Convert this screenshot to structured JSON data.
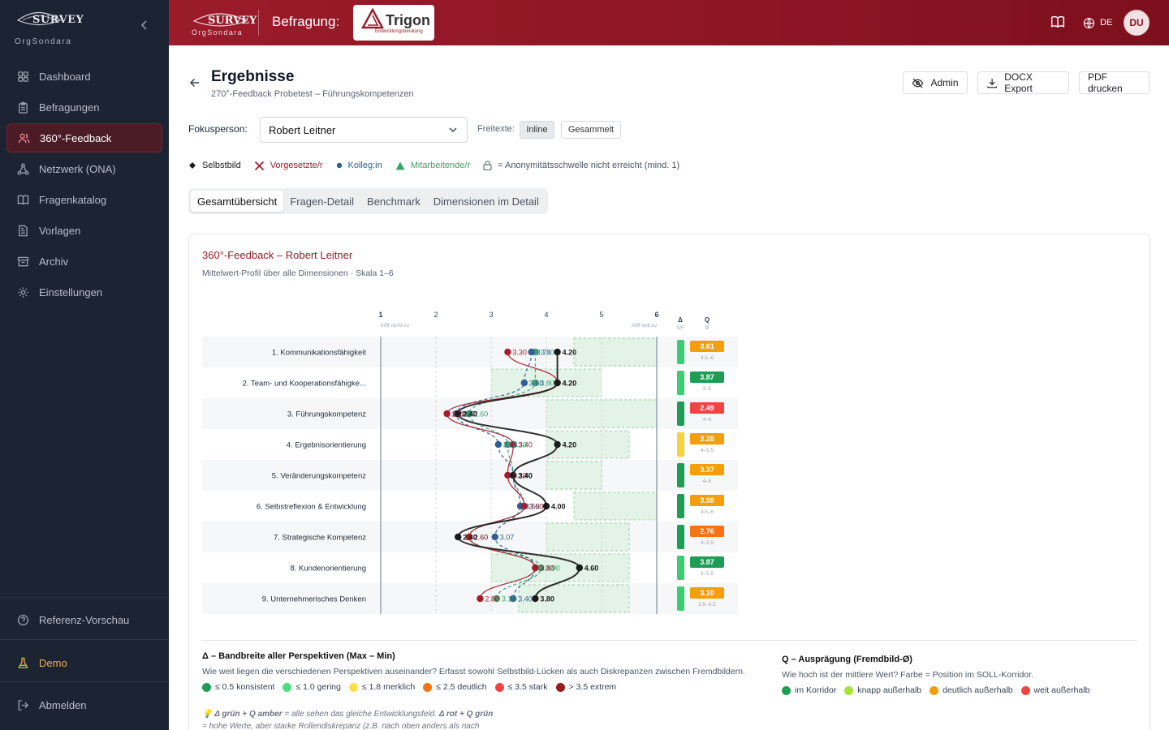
{
  "app": {
    "brand": "SURVEY",
    "brand_sub": "OrgSondara",
    "survey_label": "Befragung:",
    "client_name": "Trigon",
    "client_tag": "Entwicklungsberatung",
    "language": "DE",
    "avatar_initials": "DU",
    "accent_color": "#9b1b2a"
  },
  "sidebar": {
    "items": [
      {
        "label": "Dashboard",
        "icon": "grid-icon"
      },
      {
        "label": "Befragungen",
        "icon": "clipboard-icon"
      },
      {
        "label": "360°-Feedback",
        "icon": "users-icon",
        "active": true
      },
      {
        "label": "Netzwerk (ONA)",
        "icon": "network-icon"
      },
      {
        "label": "Fragenkatalog",
        "icon": "book-icon"
      },
      {
        "label": "Vorlagen",
        "icon": "file-icon"
      },
      {
        "label": "Archiv",
        "icon": "archive-icon"
      },
      {
        "label": "Einstellungen",
        "icon": "gear-icon"
      }
    ],
    "reference_preview": "Referenz-Vorschau",
    "demo": "Demo",
    "logout": "Abmelden"
  },
  "page": {
    "title": "Ergebnisse",
    "subtitle": "270°-Feedback Probetest – Führungskompetenzen",
    "buttons": {
      "admin": "Admin",
      "docx": "DOCX Export",
      "pdf": "PDF drucken"
    },
    "focus_label": "Fokusperson:",
    "focus_value": "Robert Leitner",
    "freitexte_label": "Freitexte:",
    "freitexte_options": [
      "Inline",
      "Gesammelt"
    ],
    "legend": {
      "self": "Selbstbild",
      "supervisor": "Vorgesetzte/r",
      "colleague": "Kolleg:in",
      "employee": "Mitarbeitende/r",
      "anonymity": "= Anonymitätsschwelle nicht erreicht (mind. 1)"
    },
    "tabs": [
      "Gesamtübersicht",
      "Fragen-Detail",
      "Benchmark",
      "Dimensionen im Detail"
    ]
  },
  "card": {
    "title": "360°-Feedback – Robert Leitner",
    "subtitle": "Mittelwert-Profil über alle Dimensionen · Skala 1–6"
  },
  "chart_data": {
    "type": "line",
    "scale": [
      1,
      2,
      3,
      4,
      5,
      6
    ],
    "scale_low_label": "trifft nicht zu",
    "scale_high_label": "trifft voll zu",
    "delta_header": "Δ",
    "delta_sub": "S/F",
    "q_header": "Q",
    "q_sub": "Ø",
    "colors": {
      "self": "#1a1a1a",
      "supervisor": "#a51d2d",
      "colleague": "#2f5f94",
      "employee": "#3aa36a"
    },
    "dimensions": [
      {
        "label": "1. Kommunikationsfähigkeit",
        "self": 4.2,
        "supervisor": 3.3,
        "colleague": 3.73,
        "employee": 3.8,
        "self_label": "4.20",
        "supervisor_label": "3.30",
        "colleague_label": "3.73",
        "employee_label": "3.80",
        "corridor": [
          4.5,
          6
        ],
        "corridor_label": "4.5–6",
        "q": "3.61",
        "q_color": "#f59e0b",
        "delta_color": "#3ccd73"
      },
      {
        "label": "2. Team- und Kooperationsfähigke...",
        "self": 4.2,
        "supervisor": 4.2,
        "colleague": 3.6,
        "employee": 3.8,
        "self_label": "4.20",
        "supervisor_label": "4.20",
        "colleague_label": "3.60",
        "employee_label": "3.80",
        "corridor": [
          3,
          5
        ],
        "corridor_label": "3–5",
        "q": "3.87",
        "q_color": "#1f9d55",
        "delta_color": "#3ccd73"
      },
      {
        "label": "3. Führungskompetenz",
        "self": 2.4,
        "supervisor": 2.2,
        "colleague": 2.37,
        "employee": 2.6,
        "self_label": "2.40",
        "supervisor_label": "2.20",
        "colleague_label": "2.37",
        "employee_label": "2.60",
        "corridor": [
          4,
          6
        ],
        "corridor_label": "4–6",
        "q": "2.49",
        "q_color": "#ef4444",
        "delta_color": "#1f9d55"
      },
      {
        "label": "4. Ergebnisorientierung",
        "self": 4.2,
        "supervisor": 3.4,
        "colleague": 3.13,
        "employee": 3.3,
        "self_label": "4.20",
        "supervisor_label": "3.40",
        "colleague_label": "3.13",
        "employee_label": "3.30",
        "corridor": [
          4,
          5.5
        ],
        "corridor_label": "4–5.5",
        "q": "3.28",
        "q_color": "#f59e0b",
        "delta_color": "#f7d23e"
      },
      {
        "label": "5. Veränderungskompetenz",
        "self": 3.4,
        "supervisor": 3.3,
        "colleague": 3.4,
        "employee": 3.4,
        "self_label": "3.40",
        "supervisor_label": "3.30",
        "colleague_label": "3.40",
        "employee_label": "3.40",
        "corridor": [
          4,
          5
        ],
        "corridor_label": "4–5",
        "q": "3.37",
        "q_color": "#f59e0b",
        "delta_color": "#1f9d55"
      },
      {
        "label": "6. Selbstreflexion & Entwicklung",
        "self": 4.0,
        "supervisor": 3.6,
        "colleague": 3.53,
        "employee": 3.6,
        "self_label": "4.00",
        "supervisor_label": "3.60",
        "colleague_label": "3.53",
        "employee_label": "3.60",
        "corridor": [
          4.5,
          6
        ],
        "corridor_label": "4.5–6",
        "q": "3.58",
        "q_color": "#f59e0b",
        "delta_color": "#1f9d55"
      },
      {
        "label": "7. Strategische Kompetenz",
        "self": 2.4,
        "supervisor": 2.6,
        "colleague": 3.07,
        "employee": 2.6,
        "self_label": "2.40",
        "supervisor_label": "2.60",
        "colleague_label": "3.07",
        "employee_label": "2.60",
        "corridor": [
          4,
          5.5
        ],
        "corridor_label": "4–5.5",
        "q": "2.76",
        "q_color": "#f97316",
        "delta_color": "#1f9d55"
      },
      {
        "label": "8. Kundenorientierung",
        "self": 4.6,
        "supervisor": 3.8,
        "colleague": 3.8,
        "employee": 3.9,
        "self_label": "4.60",
        "supervisor_label": "3.80",
        "colleague_label": "3.80",
        "employee_label": "3.90",
        "corridor": [
          3,
          5.5
        ],
        "corridor_label": "3–5.5",
        "q": "3.87",
        "q_color": "#1f9d55",
        "delta_color": "#3ccd73"
      },
      {
        "label": "9. Unternehmerisches Denken",
        "self": 3.8,
        "supervisor": 2.8,
        "colleague": 3.4,
        "employee": 3.1,
        "self_label": "3.80",
        "supervisor_label": "2.80",
        "colleague_label": "3.40",
        "employee_label": "3.10",
        "corridor": [
          3.5,
          5.5
        ],
        "corridor_label": "3.5–5.5",
        "q": "3.10",
        "q_color": "#f59e0b",
        "delta_color": "#3ccd73"
      }
    ]
  },
  "explain": {
    "delta_title": "Δ – Bandbreite aller Perspektiven (Max – Min)",
    "delta_text": "Wie weit liegen die verschiedenen Perspektiven auseinander? Erfasst sowohl Selbstbild-Lücken als auch Diskrepanzen zwischen Fremdbildern.",
    "delta_chips": [
      {
        "label": "≤ 0.5 konsistent",
        "color": "#1f9d55"
      },
      {
        "label": "≤ 1.0 gering",
        "color": "#4ade80"
      },
      {
        "label": "≤ 1.8 merklich",
        "color": "#fde047"
      },
      {
        "label": "≤ 2.5 deutlich",
        "color": "#f97316"
      },
      {
        "label": "≤ 3.5 stark",
        "color": "#ef4444"
      },
      {
        "label": "> 3.5 extrem",
        "color": "#991b1b"
      }
    ],
    "q_title": "Q – Ausprägung (Fremdbild-Ø)",
    "q_text": "Wie hoch ist der mittlere Wert? Farbe = Position im SOLL-Korridor.",
    "q_chips": [
      {
        "label": "im Korridor",
        "color": "#1f9d55"
      },
      {
        "label": "knapp außerhalb",
        "color": "#a3e635"
      },
      {
        "label": "deutlich außerhalb",
        "color": "#f59e0b"
      },
      {
        "label": "weit außerhalb",
        "color": "#ef4444"
      }
    ],
    "tip_bold_1": "Δ grün + Q amber",
    "tip_text_1": " = alle sehen das gleiche Entwicklungsfeld. ",
    "tip_bold_2": "Δ rot + Q grün",
    "tip_text_2": "= hohe Werte, aber starke Rollendiskrepanz (z.B. nach oben anders als nach"
  }
}
